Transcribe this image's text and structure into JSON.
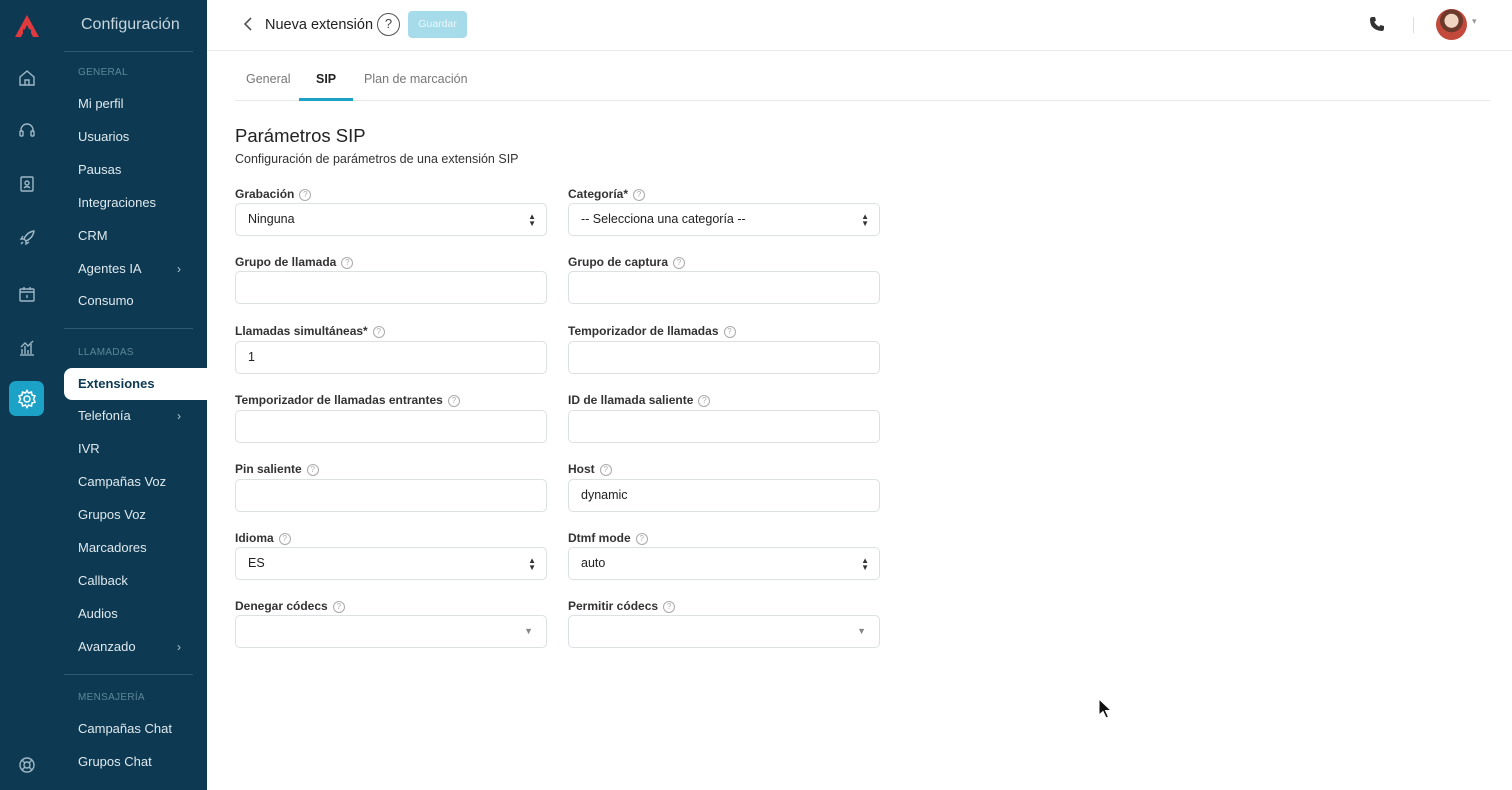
{
  "sidebar": {
    "title": "Configuración",
    "sections": [
      {
        "header": "GENERAL",
        "items": [
          "Mi perfil",
          "Usuarios",
          "Pausas",
          "Integraciones",
          "CRM",
          "Agentes IA",
          "Consumo"
        ]
      },
      {
        "header": "LLAMADAS",
        "items": [
          "Extensiones",
          "Telefonía",
          "IVR",
          "Campañas Voz",
          "Grupos Voz",
          "Marcadores",
          "Callback",
          "Audios",
          "Avanzado"
        ]
      },
      {
        "header": "MENSAJERÍA",
        "items": [
          "Campañas Chat",
          "Grupos Chat"
        ]
      }
    ],
    "active_item": "Extensiones"
  },
  "rail": {
    "icons": [
      "logo-icon",
      "home-icon",
      "headset-icon",
      "contacts-icon",
      "rocket-icon",
      "calendar-icon",
      "chart-icon",
      "settings-icon",
      "support-icon"
    ],
    "active": "settings-icon"
  },
  "header": {
    "title": "Nueva extensión",
    "help_label": "?",
    "save_label": "Guardar"
  },
  "tabs": [
    "General",
    "SIP",
    "Plan de marcación"
  ],
  "active_tab": "SIP",
  "section": {
    "title": "Parámetros SIP",
    "subtitle": "Configuración de parámetros de una extensión SIP"
  },
  "fields": {
    "grabacion": {
      "label": "Grabación",
      "value": "Ninguna"
    },
    "categoria": {
      "label": "Categoría*",
      "value": "-- Selecciona una categoría --"
    },
    "grupo_llamada": {
      "label": "Grupo de llamada",
      "value": ""
    },
    "grupo_captura": {
      "label": "Grupo de captura",
      "value": ""
    },
    "llamadas_simultaneas": {
      "label": "Llamadas simultáneas*",
      "value": "1"
    },
    "temporizador_llamadas": {
      "label": "Temporizador de llamadas",
      "value": ""
    },
    "temporizador_entrantes": {
      "label": "Temporizador de llamadas entrantes",
      "value": ""
    },
    "id_llamada_saliente": {
      "label": "ID de llamada saliente",
      "value": ""
    },
    "pin_saliente": {
      "label": "Pin saliente",
      "value": ""
    },
    "host": {
      "label": "Host",
      "value": "dynamic"
    },
    "idioma": {
      "label": "Idioma",
      "value": "ES"
    },
    "dtmf_mode": {
      "label": "Dtmf mode",
      "value": "auto"
    },
    "denegar_codecs": {
      "label": "Denegar códecs",
      "value": ""
    },
    "permitir_codecs": {
      "label": "Permitir códecs",
      "value": ""
    }
  },
  "colors": {
    "sidebar_bg": "#0d3a52",
    "accent": "#1ba2c6",
    "brand_red": "#e0393e"
  }
}
